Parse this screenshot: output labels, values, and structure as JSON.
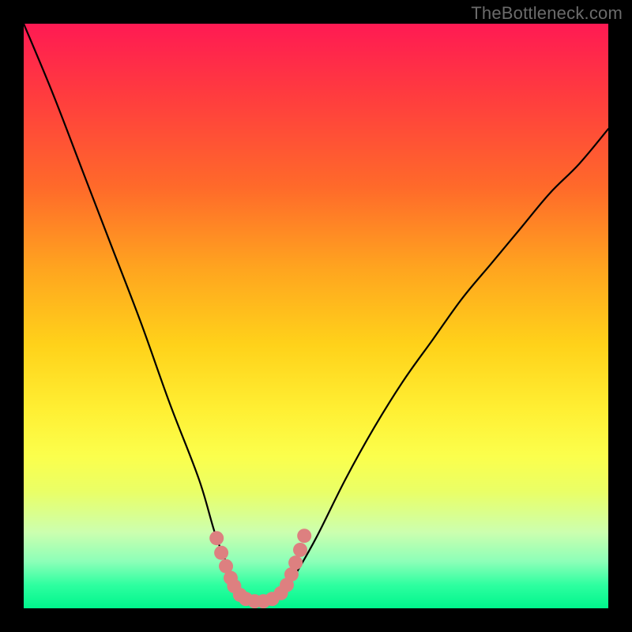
{
  "watermark": "TheBottleneck.com",
  "chart_data": {
    "type": "line",
    "title": "",
    "xlabel": "",
    "ylabel": "",
    "xlim": [
      0,
      100
    ],
    "ylim": [
      0,
      100
    ],
    "series": [
      {
        "name": "bottleneck-curve",
        "x": [
          0,
          5,
          10,
          15,
          20,
          25,
          30,
          33,
          36,
          38,
          40,
          42,
          44,
          46,
          50,
          55,
          60,
          65,
          70,
          75,
          80,
          85,
          90,
          95,
          100
        ],
        "y": [
          100,
          88,
          75,
          62,
          49,
          35,
          22,
          12,
          5,
          2,
          1,
          1,
          2,
          5,
          12,
          22,
          31,
          39,
          46,
          53,
          59,
          65,
          71,
          76,
          82
        ]
      }
    ],
    "markers": {
      "name": "highlight-dots",
      "color": "#dd8080",
      "x": [
        33.0,
        33.8,
        34.6,
        35.4,
        36.0,
        37.0,
        38.0,
        39.5,
        41.0,
        42.5,
        44.0,
        45.0,
        45.8,
        46.5,
        47.3,
        48.0
      ],
      "y": [
        12.0,
        9.5,
        7.2,
        5.2,
        3.8,
        2.3,
        1.6,
        1.2,
        1.2,
        1.6,
        2.6,
        4.0,
        5.8,
        7.8,
        10.0,
        12.4
      ]
    }
  }
}
